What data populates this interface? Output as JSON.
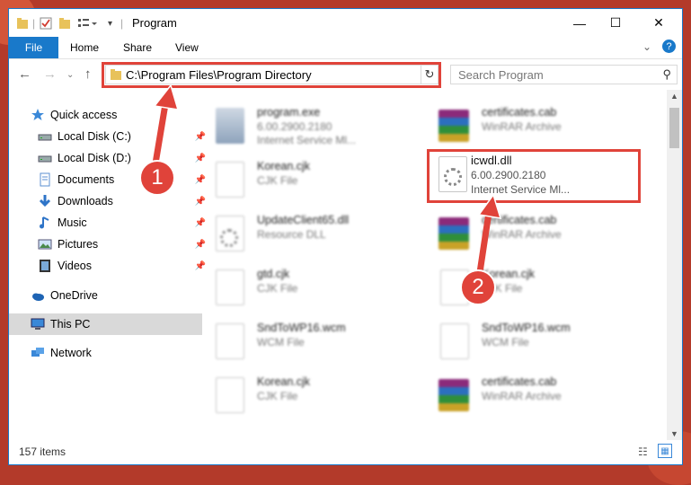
{
  "window": {
    "title": "Program",
    "accent": "#1979ca"
  },
  "ribbon": {
    "tabs": [
      "File",
      "Home",
      "Share",
      "View"
    ]
  },
  "address": {
    "path": "C:\\Program Files\\Program Directory",
    "search_placeholder": "Search Program"
  },
  "sidebar": {
    "items": [
      {
        "label": "Quick access",
        "icon": "star-icon",
        "pinned": false
      },
      {
        "label": "Local Disk (C:)",
        "icon": "drive-icon",
        "pinned": true
      },
      {
        "label": "Local Disk (D:)",
        "icon": "drive-icon",
        "pinned": true
      },
      {
        "label": "Documents",
        "icon": "documents-icon",
        "pinned": true
      },
      {
        "label": "Downloads",
        "icon": "download-icon",
        "pinned": true
      },
      {
        "label": "Music",
        "icon": "music-icon",
        "pinned": true
      },
      {
        "label": "Pictures",
        "icon": "pictures-icon",
        "pinned": true
      },
      {
        "label": "Videos",
        "icon": "videos-icon",
        "pinned": true
      },
      {
        "label": "OneDrive",
        "icon": "cloud-icon",
        "pinned": false
      },
      {
        "label": "This PC",
        "icon": "pc-icon",
        "pinned": false
      },
      {
        "label": "Network",
        "icon": "network-icon",
        "pinned": false
      }
    ]
  },
  "files_left": [
    {
      "name": "program.exe",
      "line1": "6.00.2900.2180",
      "line2": "Internet Service Ml..."
    },
    {
      "name": "Korean.cjk",
      "line1": "CJK File",
      "line2": ""
    },
    {
      "name": "UpdateClient65.dll",
      "line1": "Resource DLL",
      "line2": ""
    },
    {
      "name": "gtd.cjk",
      "line1": "CJK File",
      "line2": ""
    },
    {
      "name": "SndToWP16.wcm",
      "line1": "WCM File",
      "line2": ""
    },
    {
      "name": "Korean.cjk",
      "line1": "CJK File",
      "line2": ""
    }
  ],
  "files_right": [
    {
      "name": "certificates.cab",
      "line1": "WinRAR Archive",
      "line2": ""
    },
    {
      "name": "certificates.cab",
      "line1": "WinRAR Archive",
      "line2": ""
    },
    {
      "name": "Korean.cjk",
      "line1": "CJK File",
      "line2": ""
    },
    {
      "name": "SndToWP16.wcm",
      "line1": "WCM File",
      "line2": ""
    },
    {
      "name": "certificates.cab",
      "line1": "WinRAR Archive",
      "line2": ""
    }
  ],
  "highlighted_file": {
    "name": "icwdl.dll",
    "version": "6.00.2900.2180",
    "description": "Internet Service Ml..."
  },
  "status": {
    "count": "157 items"
  },
  "callouts": {
    "one": "1",
    "two": "2"
  }
}
